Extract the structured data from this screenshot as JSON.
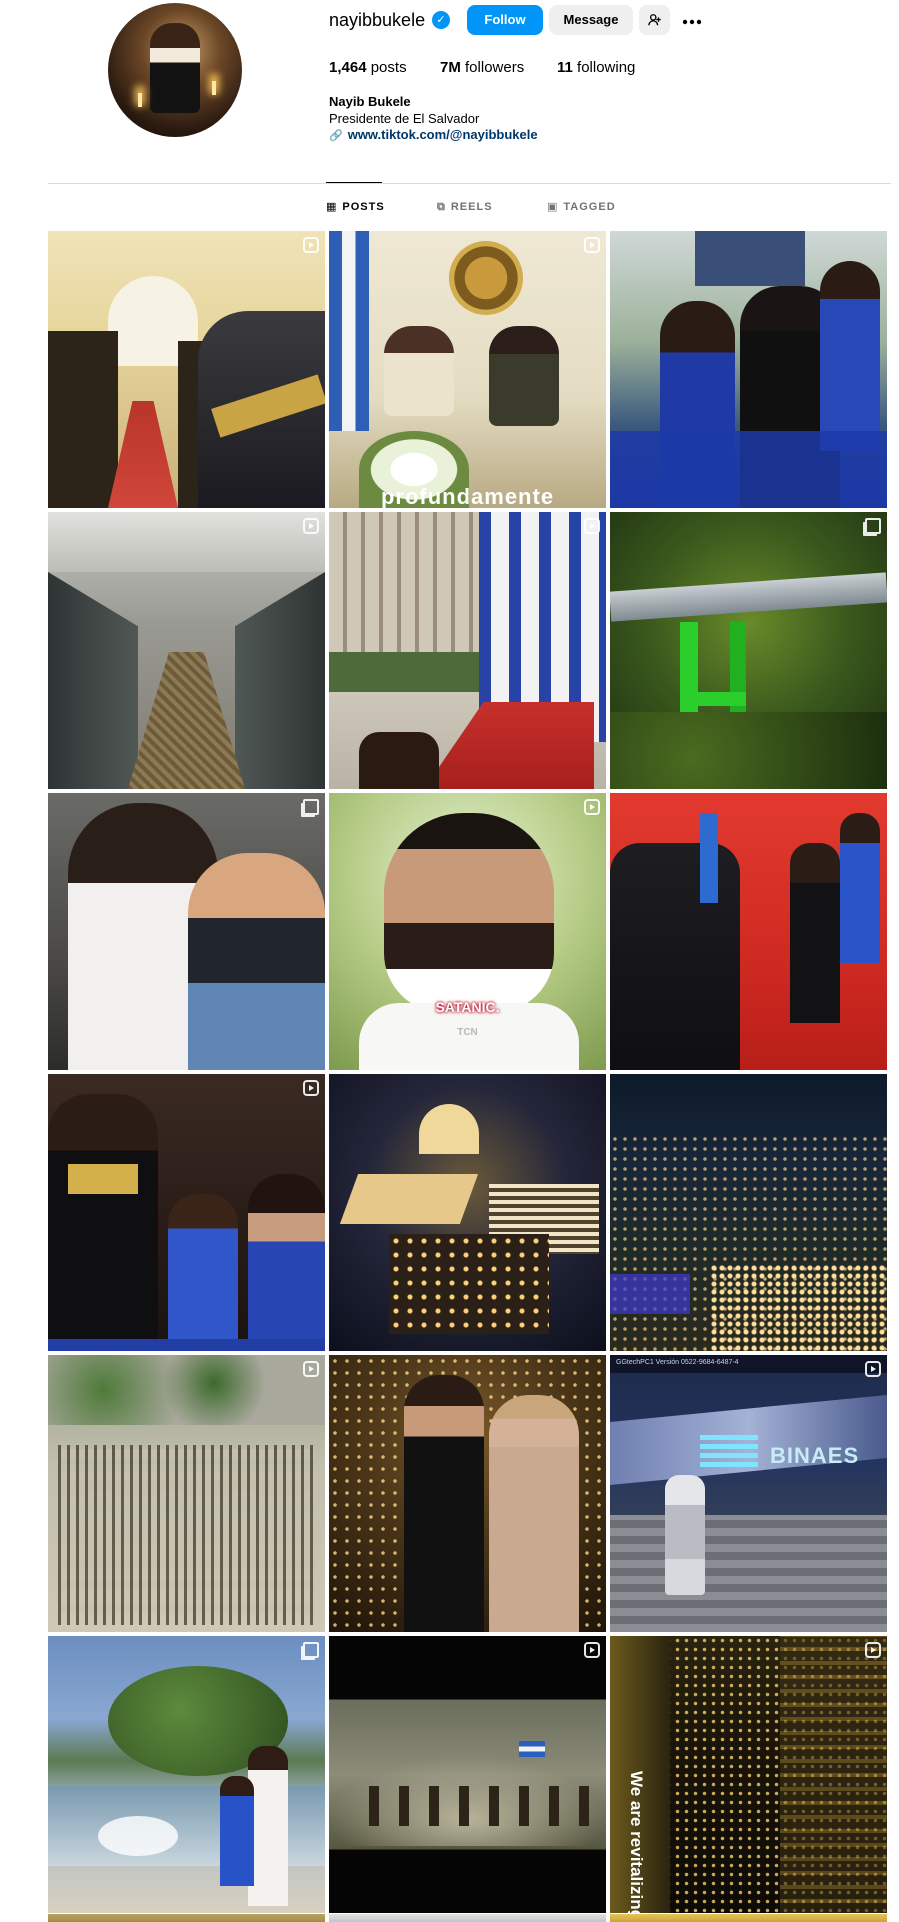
{
  "profile": {
    "username": "nayibbukele",
    "verified_glyph": "✓",
    "follow_label": "Follow",
    "message_label": "Message",
    "add_user_icon": "add-user-icon",
    "more_icon": "more-options-icon",
    "posts_count": "1,464",
    "posts_label": "posts",
    "followers_count": "7M",
    "followers_label": "followers",
    "following_count": "11",
    "following_label": "following",
    "full_name": "Nayib Bukele",
    "bio": "Presidente de El Salvador",
    "link": "www.tiktok.com/@nayibbukele"
  },
  "tabs": {
    "posts": "POSTS",
    "reels": "REELS",
    "tagged": "TAGGED"
  },
  "colors": {
    "accent": "#0095f6",
    "link": "#00376b",
    "secondary_button": "#efefef",
    "divider": "#dbdbdb",
    "muted_text": "#737373"
  },
  "posts": [
    {
      "type": "reel",
      "caption": ""
    },
    {
      "type": "reel",
      "caption": "profundamente"
    },
    {
      "type": "none",
      "caption": ""
    },
    {
      "type": "reel",
      "caption": ""
    },
    {
      "type": "reel",
      "caption": ""
    },
    {
      "type": "carousel",
      "caption": ""
    },
    {
      "type": "carousel",
      "caption": ""
    },
    {
      "type": "reel",
      "caption": "SATANIC.",
      "watermark": "TCN"
    },
    {
      "type": "none",
      "caption": ""
    },
    {
      "type": "reel",
      "caption": ""
    },
    {
      "type": "none",
      "caption": ""
    },
    {
      "type": "none",
      "caption": ""
    },
    {
      "type": "reel",
      "caption": ""
    },
    {
      "type": "none",
      "caption": ""
    },
    {
      "type": "reel",
      "caption": "",
      "sign": "BINAES",
      "overlay": "GGtechPC1   Versión 0522-9684-6487-4"
    },
    {
      "type": "carousel",
      "caption": ""
    },
    {
      "type": "reel",
      "caption": ""
    },
    {
      "type": "reel",
      "caption": "We are revitalizing"
    }
  ]
}
